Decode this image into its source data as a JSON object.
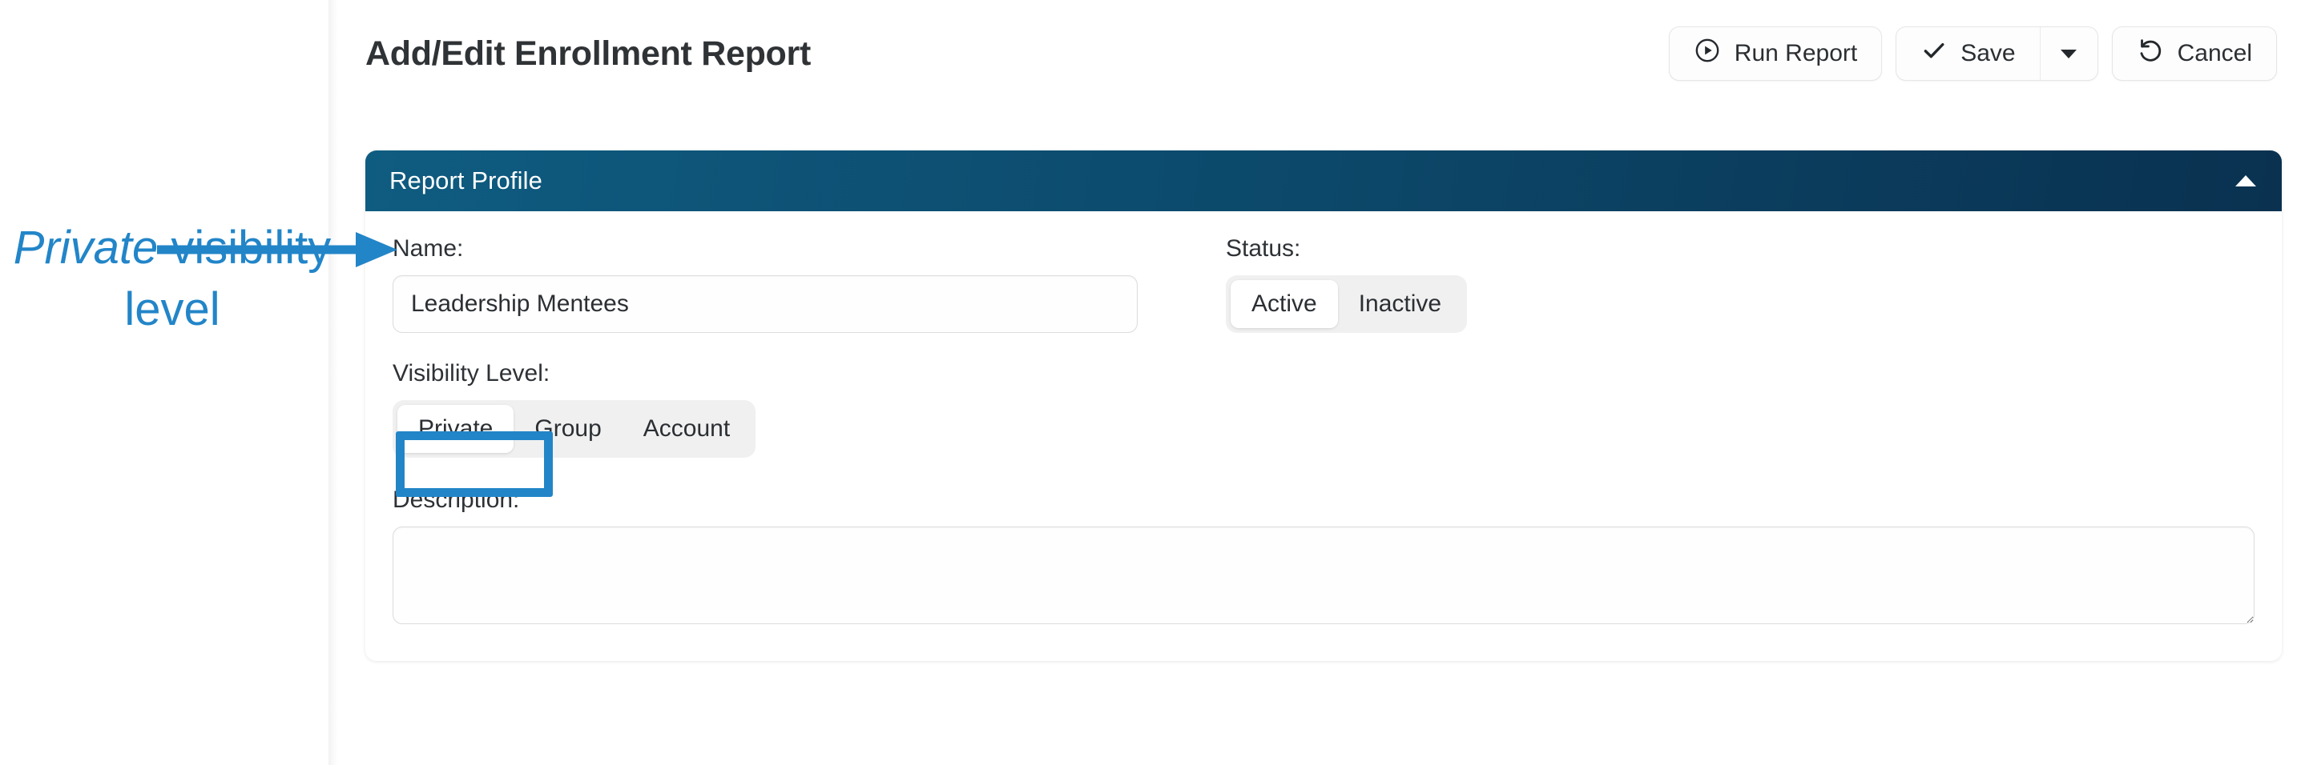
{
  "header": {
    "title": "Add/Edit Enrollment Report",
    "actions": {
      "run_report": {
        "label": "Run Report",
        "icon": "play-circle-icon"
      },
      "save": {
        "label": "Save",
        "icon": "check-icon"
      },
      "save_dropdown": {
        "icon": "chevron-down-icon"
      },
      "cancel": {
        "label": "Cancel",
        "icon": "undo-icon"
      }
    }
  },
  "card": {
    "title": "Report Profile",
    "collapse_icon": "caret-up-icon",
    "fields": {
      "name": {
        "label": "Name:",
        "value": "Leadership Mentees",
        "placeholder": ""
      },
      "status": {
        "label": "Status:",
        "options": [
          "Active",
          "Inactive"
        ],
        "selected": "Active"
      },
      "visibility_level": {
        "label": "Visibility Level:",
        "options": [
          "Private",
          "Group",
          "Account"
        ],
        "selected": "Private"
      },
      "description": {
        "label": "Description:",
        "value": "",
        "placeholder": ""
      }
    }
  },
  "annotation": {
    "emphasis_word": "Private",
    "rest_text": " visibility level",
    "color": "#2285c8"
  },
  "colors": {
    "card_header_gradient_start": "#0f5c81",
    "card_header_gradient_end": "#0a3150",
    "annotation_blue": "#2285c8",
    "page_background": "#ffffff",
    "segmented_track": "#f0f0f0"
  }
}
